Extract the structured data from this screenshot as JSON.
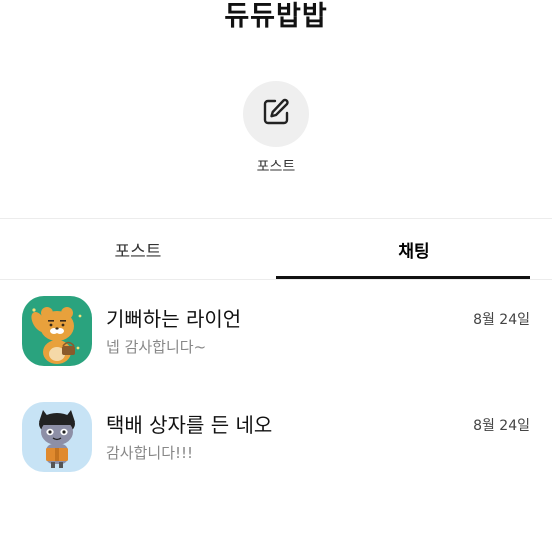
{
  "profile": {
    "name": "듀듀밥밥"
  },
  "post_action": {
    "icon": "edit-icon",
    "label": "포스트"
  },
  "tabs": [
    {
      "label": "포스트",
      "active": false
    },
    {
      "label": "채팅",
      "active": true
    }
  ],
  "chats": [
    {
      "name": "기뻐하는 라이언",
      "preview": "넵 감사합니다~",
      "date": "8월 24일",
      "avatar_icon": "ryan-character-icon",
      "avatar_bg": "#2aa37e"
    },
    {
      "name": "택배 상자를 든 네오",
      "preview": "감사합니다!!!",
      "date": "8월 24일",
      "avatar_icon": "neo-character-icon",
      "avatar_bg": "#c7e3f5"
    }
  ]
}
